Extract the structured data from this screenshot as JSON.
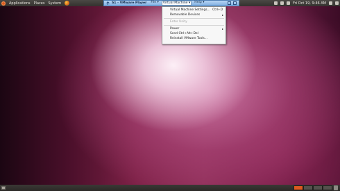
{
  "top_panel": {
    "menu": [
      "Applications",
      "Places",
      "System"
    ],
    "clock": "Fri Oct 19,  9:46 AM"
  },
  "vmware_bar": {
    "title": "S1 - VMware Player",
    "menus": [
      {
        "label": "File ▾"
      },
      {
        "label": "Virtual Machine ▾"
      },
      {
        "label": "Help ▾"
      }
    ]
  },
  "dropdown": {
    "items": [
      {
        "label": "Virtual Machine Settings...",
        "shortcut": "Ctrl+D",
        "disabled": false,
        "submenu": false
      },
      {
        "label": "Removable Devices",
        "shortcut": "",
        "disabled": false,
        "submenu": true
      },
      {
        "label": "Enter Unity",
        "shortcut": "",
        "disabled": true,
        "submenu": false
      },
      {
        "label": "Power",
        "shortcut": "",
        "disabled": false,
        "submenu": true
      },
      {
        "label": "Send Ctrl+Alt+Del",
        "shortcut": "",
        "disabled": false,
        "submenu": false
      },
      {
        "label": "Reinstall VMware Tools...",
        "shortcut": "",
        "disabled": false,
        "submenu": false
      }
    ]
  },
  "colors": {
    "accent": "#dd5a1e",
    "toolbar_blue": "#9ec3ec"
  },
  "icons": [
    "ubuntu-logo-icon",
    "firefox-icon",
    "pin-icon",
    "network-icon",
    "volume-icon",
    "mail-icon",
    "user-icon",
    "power-icon",
    "show-desktop-icon",
    "trash-icon"
  ]
}
